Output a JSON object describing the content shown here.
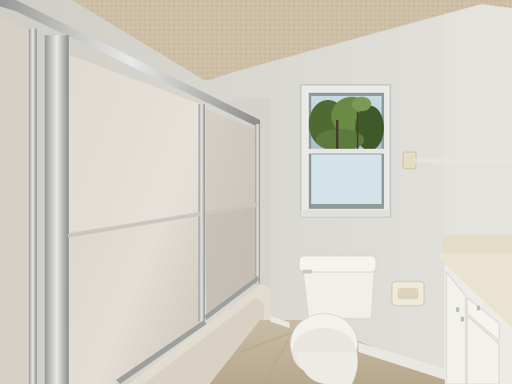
{
  "scene": {
    "kind": "photo",
    "subject": "bathroom",
    "elements": [
      "textured-ceiling",
      "wall",
      "window",
      "sliding-shower-door-frosted",
      "bathtub",
      "toilet",
      "toilet-paper-holder",
      "towel-bar",
      "vanity-cabinet",
      "countertop",
      "tile-floor",
      "baseboard"
    ],
    "colors": {
      "wall": "#dcdbd5",
      "ceiling": "#cdbfa8",
      "glass": "#e3ddd4",
      "frame": "#b8b8b5",
      "porcelain": "#f1efe9",
      "floor": "#c6b79f",
      "foliage": "#5d7a3f",
      "sky": "#bdd2dc"
    }
  }
}
